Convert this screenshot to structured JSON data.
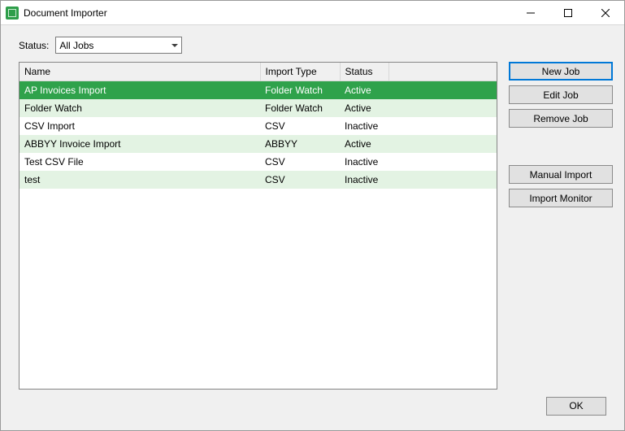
{
  "window": {
    "title": "Document Importer"
  },
  "filter": {
    "label": "Status:",
    "value": "All Jobs"
  },
  "table": {
    "headers": {
      "name": "Name",
      "import_type": "Import Type",
      "status": "Status"
    },
    "rows": [
      {
        "name": "AP Invoices Import",
        "import_type": "Folder Watch",
        "status": "Active",
        "selected": true
      },
      {
        "name": "Folder Watch",
        "import_type": "Folder Watch",
        "status": "Active",
        "selected": false
      },
      {
        "name": "CSV Import",
        "import_type": "CSV",
        "status": "Inactive",
        "selected": false
      },
      {
        "name": "ABBYY Invoice Import",
        "import_type": "ABBYY",
        "status": "Active",
        "selected": false
      },
      {
        "name": "Test CSV File",
        "import_type": "CSV",
        "status": "Inactive",
        "selected": false
      },
      {
        "name": "test",
        "import_type": "CSV",
        "status": "Inactive",
        "selected": false
      }
    ]
  },
  "buttons": {
    "new_job": "New Job",
    "edit_job": "Edit Job",
    "remove_job": "Remove Job",
    "manual_import": "Manual Import",
    "import_monitor": "Import Monitor",
    "ok": "OK"
  }
}
